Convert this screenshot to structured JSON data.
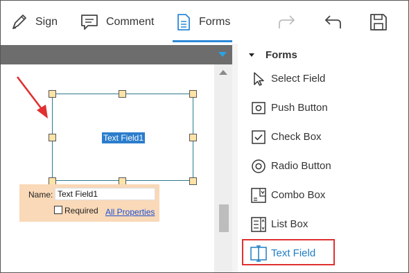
{
  "toolbar": {
    "sign_label": "Sign",
    "comment_label": "Comment",
    "forms_label": "Forms",
    "icons": {
      "sign": "pen-icon",
      "comment": "comment-icon",
      "forms": "document-icon",
      "redo": "redo-icon",
      "undo": "undo-icon",
      "save": "save-icon"
    }
  },
  "document": {
    "field_name": "Text Field1",
    "properties": {
      "name_label": "Name:",
      "name_value": "Text Field1",
      "required_label": "Required",
      "required_checked": false,
      "all_properties_link": "All Properties"
    }
  },
  "forms_panel": {
    "title": "Forms",
    "items": [
      {
        "label": "Select Field",
        "icon": "cursor-arrow-icon"
      },
      {
        "label": "Push Button",
        "icon": "push-button-icon"
      },
      {
        "label": "Check Box",
        "icon": "check-box-icon"
      },
      {
        "label": "Radio Button",
        "icon": "radio-button-icon"
      },
      {
        "label": "Combo Box",
        "icon": "combo-box-icon"
      },
      {
        "label": "List Box",
        "icon": "list-box-icon"
      },
      {
        "label": "Text Field",
        "icon": "text-field-icon",
        "active": true
      }
    ]
  },
  "colors": {
    "accent": "#2b88d8",
    "selected_text_bg": "#2b7dcc",
    "property_panel_bg": "#f9d9b8",
    "highlight_border": "#e03030",
    "annotation_arrow": "#e03030",
    "active_item_text": "#1f7dc2"
  }
}
